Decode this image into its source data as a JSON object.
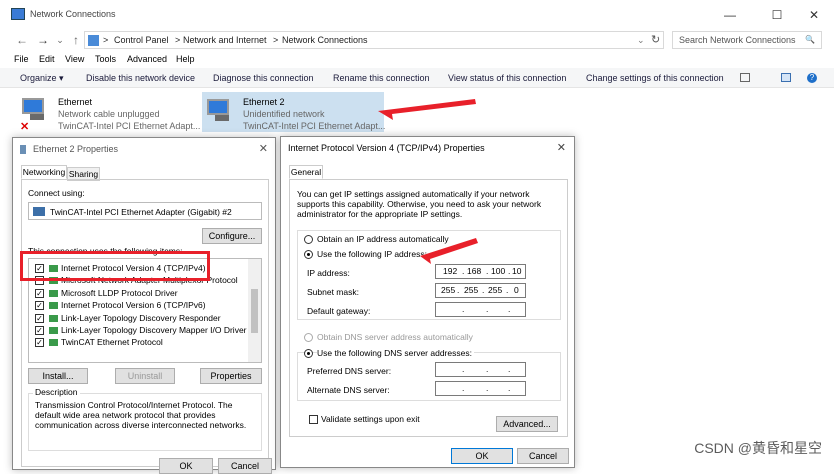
{
  "window": {
    "title": "Network Connections",
    "min": "—",
    "max": "☐",
    "close": "✕"
  },
  "nav": {
    "back": "←",
    "forward": "→",
    "recent": "⌄",
    "up": "↑",
    "refresh": "↻",
    "crumb_sep": ">",
    "crumbs": [
      "Control Panel",
      "Network and Internet",
      "Network Connections"
    ],
    "search_placeholder": "Search Network Connections",
    "search_icon": "🔍"
  },
  "menu": [
    "File",
    "Edit",
    "View",
    "Tools",
    "Advanced",
    "Help"
  ],
  "commands": [
    "Organize ▾",
    "Disable this network device",
    "Diagnose this connection",
    "Rename this connection",
    "View status of this connection",
    "Change settings of this connection"
  ],
  "adapters": [
    {
      "name": "Ethernet",
      "status": "Network cable unplugged",
      "device": "TwinCAT-Intel PCI Ethernet Adapt..."
    },
    {
      "name": "Ethernet 2",
      "status": "Unidentified network",
      "device": "TwinCAT-Intel PCI Ethernet Adapt..."
    }
  ],
  "props": {
    "title": "Ethernet 2 Properties",
    "tabs": [
      "Networking",
      "Sharing"
    ],
    "connect_using": "Connect using:",
    "adapter": "TwinCAT-Intel PCI Ethernet Adapter (Gigabit) #2",
    "configure": "Configure...",
    "items_label": "This connection uses the following items:",
    "items": [
      {
        "label": "Internet Protocol Version 4 (TCP/IPv4)",
        "checked": true
      },
      {
        "label": "Microsoft Network Adapter Multiplexor Protocol",
        "checked": false
      },
      {
        "label": "Microsoft LLDP Protocol Driver",
        "checked": true
      },
      {
        "label": "Internet Protocol Version 6 (TCP/IPv6)",
        "checked": true
      },
      {
        "label": "Link-Layer Topology Discovery Responder",
        "checked": true
      },
      {
        "label": "Link-Layer Topology Discovery Mapper I/O Driver",
        "checked": true
      },
      {
        "label": "TwinCAT Ethernet Protocol",
        "checked": true
      }
    ],
    "install": "Install...",
    "uninstall": "Uninstall",
    "properties": "Properties",
    "description_title": "Description",
    "description": "Transmission Control Protocol/Internet Protocol. The default wide area network protocol that provides communication across diverse interconnected networks.",
    "ok": "OK",
    "cancel": "Cancel"
  },
  "ipv4": {
    "title": "Internet Protocol Version 4 (TCP/IPv4) Properties",
    "tab": "General",
    "intro": "You can get IP settings assigned automatically if your network supports this capability. Otherwise, you need to ask your network administrator for the appropriate IP settings.",
    "obtain_ip": "Obtain an IP address automatically",
    "use_ip": "Use the following IP address:",
    "ip_label": "IP address:",
    "ip": [
      "192",
      "168",
      "100",
      "10"
    ],
    "mask_label": "Subnet mask:",
    "mask": [
      "255",
      "255",
      "255",
      "0"
    ],
    "gw_label": "Default gateway:",
    "dot": ".",
    "obtain_dns": "Obtain DNS server address automatically",
    "use_dns": "Use the following DNS server addresses:",
    "pref_dns": "Preferred DNS server:",
    "alt_dns": "Alternate DNS server:",
    "validate": "Validate settings upon exit",
    "advanced": "Advanced...",
    "ok": "OK",
    "cancel": "Cancel"
  },
  "watermark": "CSDN @黄昏和星空",
  "colors": {
    "highlight": "#cce0f0",
    "annot": "#e8202a"
  }
}
